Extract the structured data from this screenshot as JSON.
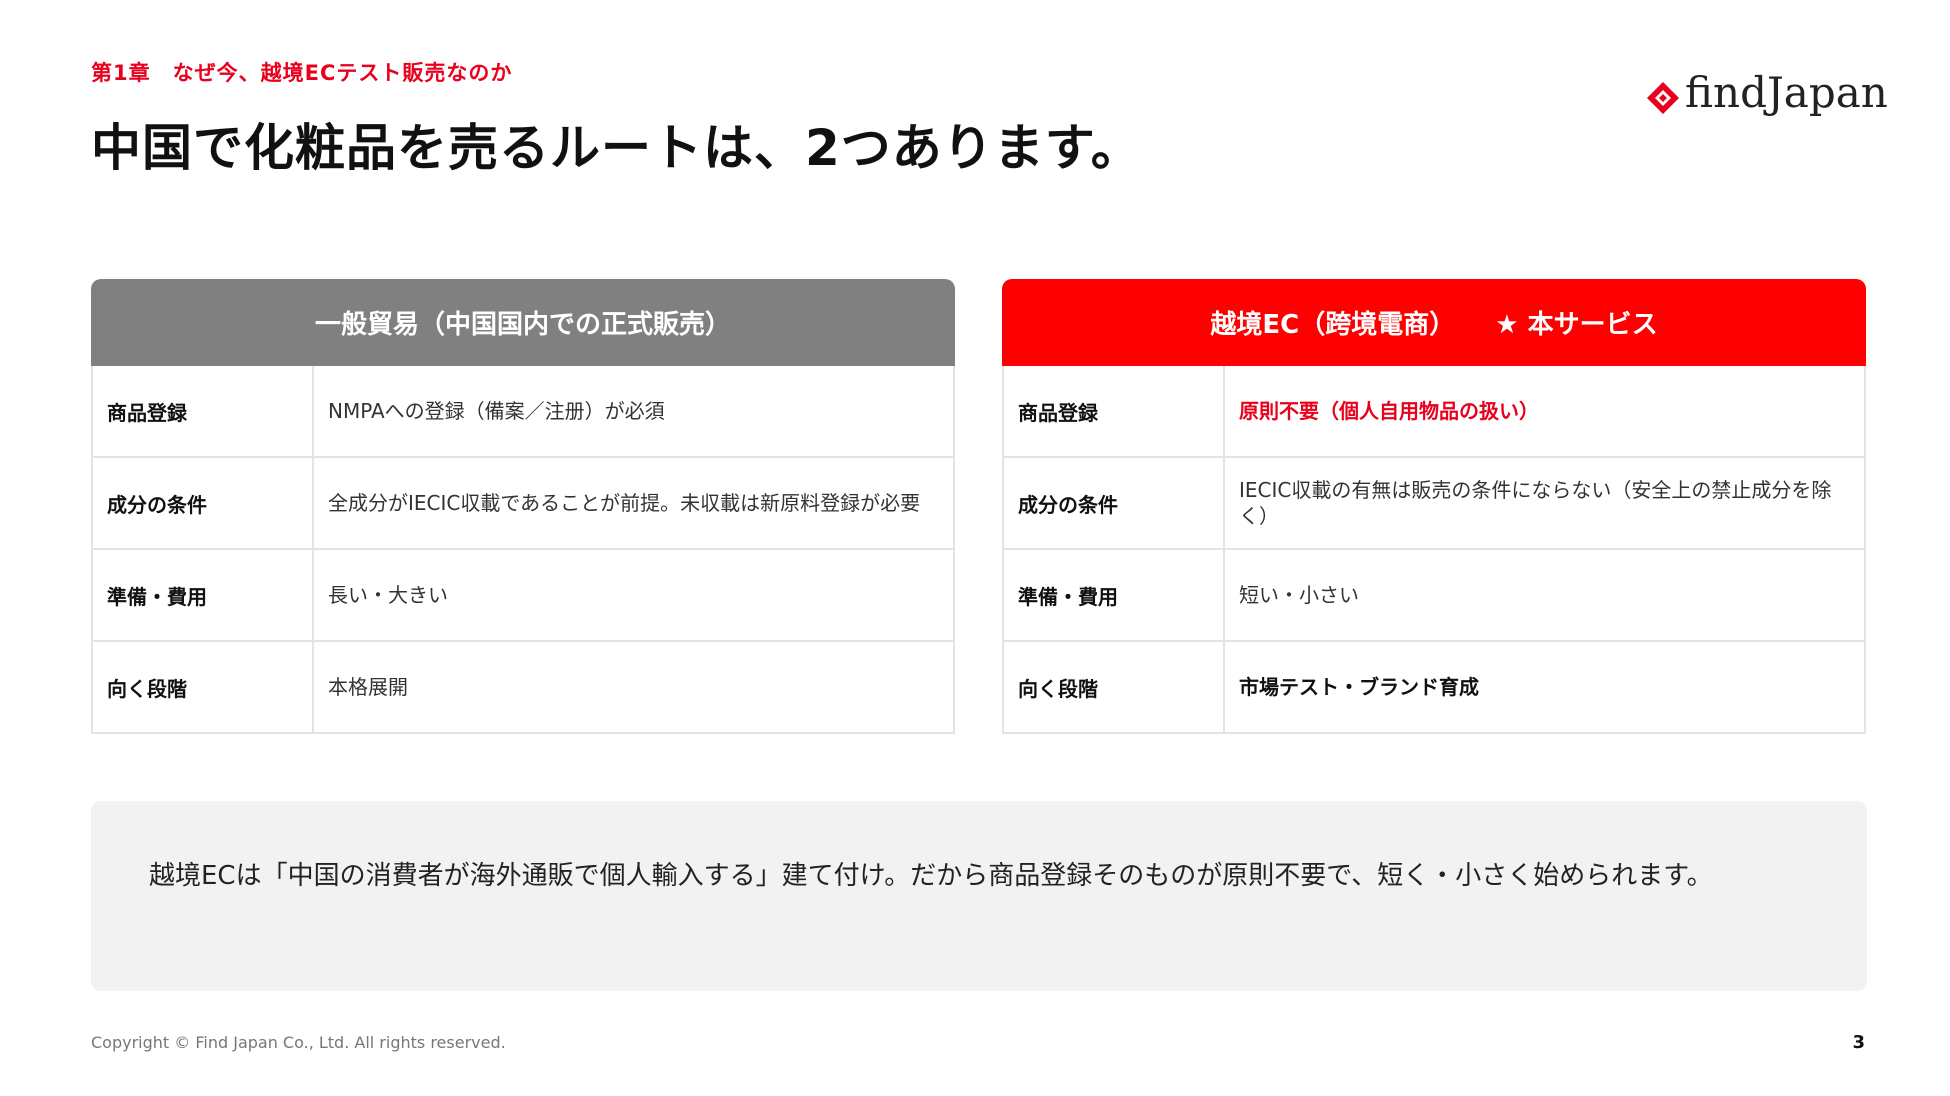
{
  "header": {
    "chapter": "第1章　なぜ今、越境ECテスト販売なのか",
    "title": "中国で化粧品を売るルートは、2つあります。"
  },
  "logo": {
    "text": "findJapan",
    "accent_color": "#e8001c"
  },
  "left_table": {
    "heading": "一般貿易（中国国内での正式販売）",
    "header_color": "#808080",
    "rows": [
      {
        "label": "商品登録",
        "value": "NMPAへの登録（備案／注册）が必須"
      },
      {
        "label": "成分の条件",
        "value": "全成分がIECIC収載であることが前提。未収載は新原料登録が必要"
      },
      {
        "label": "準備・費用",
        "value": "長い・大きい"
      },
      {
        "label": "向く段階",
        "value": "本格展開"
      }
    ]
  },
  "right_table": {
    "heading": "越境EC（跨境電商）",
    "badge": "★ 本サービス",
    "header_color": "#ff0000",
    "rows": [
      {
        "label": "商品登録",
        "value": "原則不要（個人自用物品の扱い）"
      },
      {
        "label": "成分の条件",
        "value": "IECIC収載の有無は販売の条件にならない（安全上の禁止成分を除く）"
      },
      {
        "label": "準備・費用",
        "value": "短い・小さい"
      },
      {
        "label": "向く段階",
        "value": "市場テスト・ブランド育成"
      }
    ]
  },
  "note": {
    "text": "越境ECは「中国の消費者が海外通販で個人輸入する」建て付け。だから商品登録そのものが原則不要で、短く・小さく始められます。"
  },
  "footer": {
    "copyright": "Copyright © Find Japan Co., Ltd. All rights reserved.",
    "page_number": "3"
  }
}
